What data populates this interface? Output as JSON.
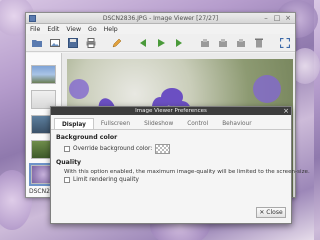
{
  "viewer": {
    "title": "DSCN2836.JPG - Image Viewer [27/27]",
    "menu": [
      "File",
      "Edit",
      "View",
      "Go",
      "Help"
    ],
    "thumbnail_label": "DSCN28"
  },
  "toolbar_icons": [
    "folder-icon",
    "image-icon",
    "save-icon",
    "print-icon",
    "edit-icon",
    "back-icon",
    "play-icon",
    "forward-icon",
    "rotate-left-icon",
    "rotate-right-icon",
    "flip-icon",
    "trash-icon",
    "fullscreen-icon"
  ],
  "dialog": {
    "title": "Image Viewer Preferences",
    "tabs": [
      "Display",
      "Fullscreen",
      "Slideshow",
      "Control",
      "Behaviour"
    ],
    "active_tab": "Display",
    "background_section": "Background color",
    "override_label": "Override background color:",
    "quality_section": "Quality",
    "quality_text": "With this option enabled, the maximum image-quality will be limited to the screen-size.",
    "limit_label": "Limit rendering quality",
    "close_label": "✕ Close"
  },
  "colors": {
    "dialog_titlebar": "#3d3d3d",
    "thumb_selected": "#6d93c9"
  }
}
